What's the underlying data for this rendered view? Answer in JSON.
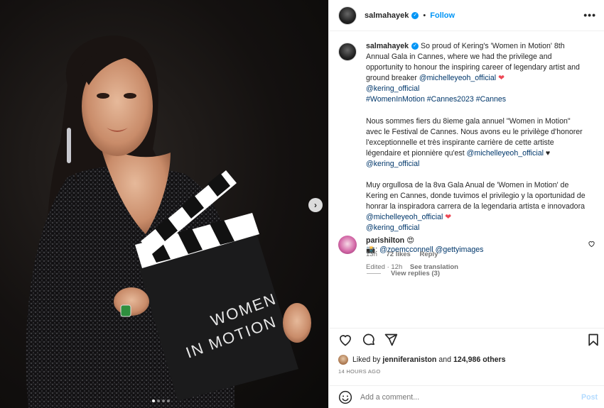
{
  "media": {
    "clapper_text_line1": "WOMEN",
    "clapper_text_line2": "IN MOTION",
    "next_symbol": "›",
    "carousel_count": 4,
    "carousel_active_index": 0
  },
  "header": {
    "username": "salmahayek",
    "separator": "•",
    "follow_label": "Follow",
    "more_label": "•••"
  },
  "caption": {
    "username": "salmahayek",
    "en_text": "So proud of Kering's 'Women in Motion' 8th Annual Gala in Cannes, where we had the privilege and opportunity to honour the inspiring career of legendary artist and ground breaker",
    "en_mention": "@michelleyeoh_official",
    "en_mention2": "@kering_official",
    "hashtags": "#WomenInMotion #Cannes2023 #Cannes",
    "fr_text": "Nous sommes fiers du 8ieme gala annuel \"Women in Motion\" avec le Festival de Cannes. Nous avons eu le privilège d'honorer l'exceptionnelle et très inspirante carrière de cette artiste légendaire et pionnière qu'est",
    "fr_mention": "@michelleyeoh_official",
    "fr_heart": "♥",
    "fr_mention2": "@kering_official",
    "es_text": "Muy orgullosa de la 8va Gala Anual de 'Women in Motion' de Kering en Cannes, donde tuvimos el privilegio y la oportunidad de honrar la inspiradora carrera de la legendaria artista e innovadora",
    "es_mention": "@michelleyeoh_official",
    "es_mention2": "@kering_official",
    "credit_emoji": "📸",
    "credit_sep": ":",
    "credit_mentions": "@zoemcconnell @gettyimages",
    "edited": "Edited · 12h",
    "see_translation": "See translation"
  },
  "comment": {
    "username": "parishilton",
    "text": "😍",
    "time": "13h",
    "likes": "72 likes",
    "reply": "Reply",
    "view_replies": "View replies (3)"
  },
  "likes": {
    "prefix": "Liked by",
    "user": "jenniferaniston",
    "and": "and",
    "others": "124,986 others"
  },
  "timestamp": "14 HOURS AGO",
  "add_comment": {
    "placeholder": "Add a comment...",
    "post_label": "Post"
  },
  "colors": {
    "link": "#00376b",
    "accent": "#0095f6",
    "heart": "#ed4956",
    "muted": "#737373"
  }
}
